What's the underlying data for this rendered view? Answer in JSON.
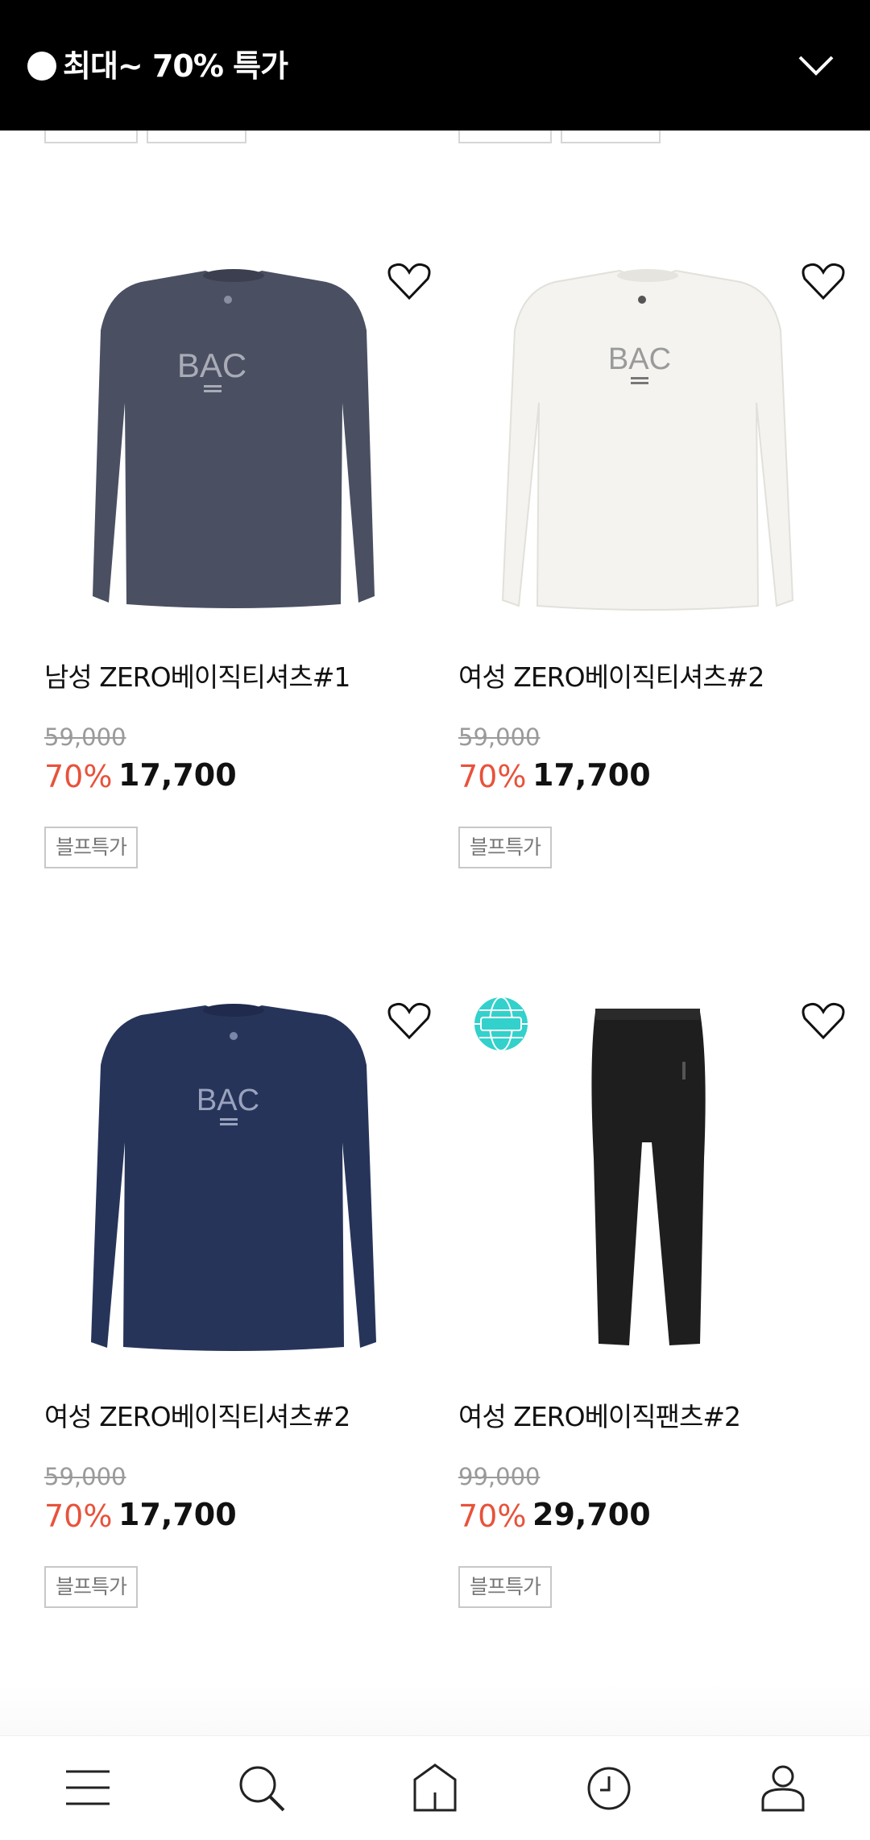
{
  "banner": {
    "title": "최대~ 70% 특가",
    "dot_color": "#ffffff",
    "background": "#000000"
  },
  "products": [
    {
      "name": "남성 ZERO베이직티셔츠#1",
      "original_price": "59,000",
      "discount": "70%",
      "price": "17,700",
      "tag": "블프특가",
      "image_icon": "navy-long-sleeve-tshirt",
      "shirt_color": "#4a4f62",
      "logo": "BAC"
    },
    {
      "name": "여성 ZERO베이직티셔츠#2",
      "original_price": "59,000",
      "discount": "70%",
      "price": "17,700",
      "tag": "블프특가",
      "image_icon": "white-long-sleeve-tshirt",
      "shirt_color": "#f4f3ef",
      "logo": "BAC"
    },
    {
      "name": "여성 ZERO베이직티셔츠#2",
      "original_price": "59,000",
      "discount": "70%",
      "price": "17,700",
      "tag": "블프특가",
      "image_icon": "navy-long-sleeve-tshirt",
      "shirt_color": "#27345a",
      "logo": "BAC"
    },
    {
      "name": "여성 ZERO베이직팬츠#2",
      "original_price": "99,000",
      "discount": "70%",
      "price": "29,700",
      "tag": "블프특가",
      "image_icon": "black-pants",
      "shirt_color": "#1e1e1e",
      "badge_icon": "plus-globe-badge"
    }
  ],
  "colors": {
    "discount": "#e8523b",
    "strike": "#9a9a9a",
    "badge": "#33d1cb"
  },
  "bottom_nav": [
    {
      "icon": "menu-icon"
    },
    {
      "icon": "search-icon"
    },
    {
      "icon": "home-icon"
    },
    {
      "icon": "recent-clock-icon"
    },
    {
      "icon": "my-page-icon"
    }
  ]
}
